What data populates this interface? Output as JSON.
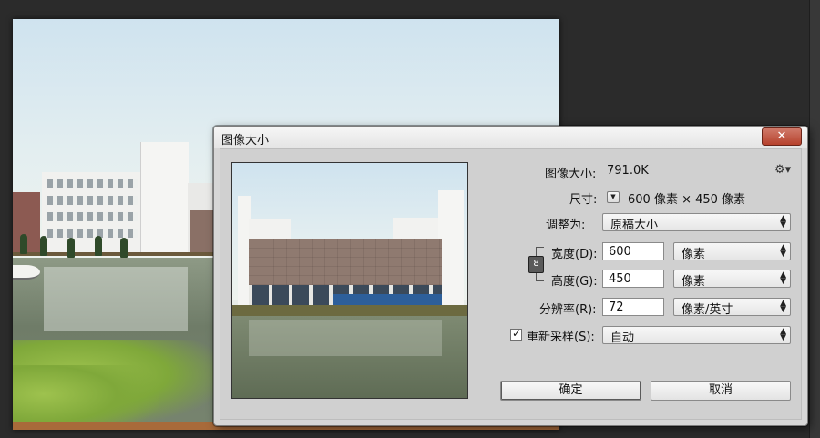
{
  "dialog": {
    "title": "图像大小",
    "close_icon": "close-icon"
  },
  "info": {
    "image_size_label": "图像大小:",
    "image_size_value": "791.0K",
    "settings_icon": "gear-icon",
    "dimensions_label": "尺寸:",
    "dimensions_value": "600 像素 × 450 像素"
  },
  "fit": {
    "label": "调整为:",
    "value": "原稿大小"
  },
  "width": {
    "label": "宽度(D):",
    "value": "600",
    "unit": "像素"
  },
  "height": {
    "label": "高度(G):",
    "value": "450",
    "unit": "像素"
  },
  "resolution": {
    "label": "分辨率(R):",
    "value": "72",
    "unit": "像素/英寸"
  },
  "resample": {
    "label": "重新采样(S):",
    "checked": true,
    "value": "自动"
  },
  "buttons": {
    "ok": "确定",
    "cancel": "取消"
  },
  "link_icon": "chain-link-icon"
}
